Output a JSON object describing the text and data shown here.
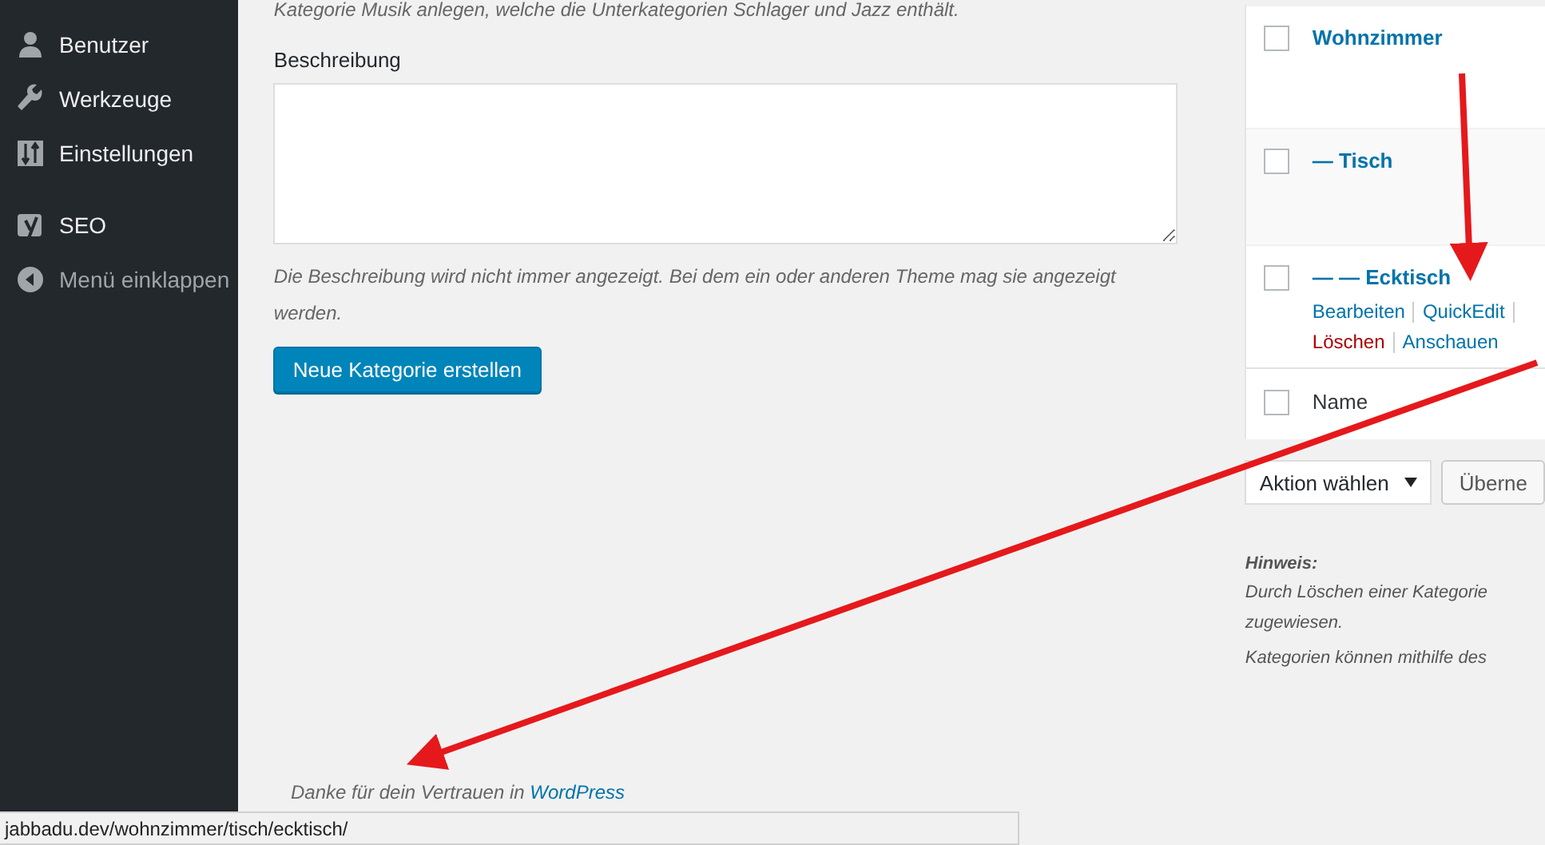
{
  "sidebar": {
    "items": [
      {
        "label": "Benutzer",
        "kind": "menu"
      },
      {
        "label": "Werkzeuge",
        "kind": "menu"
      },
      {
        "label": "Einstellungen",
        "kind": "menu"
      },
      {
        "label": "SEO",
        "kind": "group-start"
      },
      {
        "label": "Menü einklappen",
        "kind": "collapse"
      }
    ]
  },
  "form": {
    "intro": "Kategorie Musik anlegen, welche die Unterkategorien Schlager und Jazz enthält.",
    "description_label": "Beschreibung",
    "description_hint": "Die Beschreibung wird nicht immer angezeigt. Bei dem ein oder anderen Theme mag sie angezeigt werden.",
    "submit": "Neue Kategorie erstellen"
  },
  "table": {
    "rows": [
      {
        "name": "Wohnzimmer",
        "checked": false
      },
      {
        "name": "— Tisch",
        "checked": false
      },
      {
        "name": "— — Ecktisch",
        "checked": false,
        "action_lines": [
          [
            {
              "label": "Bearbeiten",
              "kind": "link"
            },
            {
              "label": "QuickEdit",
              "kind": "link"
            }
          ],
          [
            {
              "label": "Löschen",
              "kind": "delete"
            },
            {
              "label": "Anschauen",
              "kind": "link"
            }
          ]
        ]
      }
    ],
    "footer": {
      "column": "Name",
      "checked": false
    }
  },
  "bulk": {
    "action_select": "Aktion wählen",
    "apply": "Überne"
  },
  "notes": {
    "heading": "Hinweis:",
    "paragraphs": [
      [
        "Durch Löschen einer Kategorie",
        "zugewiesen."
      ],
      [
        "Kategorien können mithilfe des"
      ]
    ]
  },
  "footer": {
    "text": "Danke für dein Vertrauen in",
    "link": "WordPress"
  },
  "status_bar": {
    "url": "jabbadu.dev/wohnzimmer/tisch/ecktisch/"
  }
}
